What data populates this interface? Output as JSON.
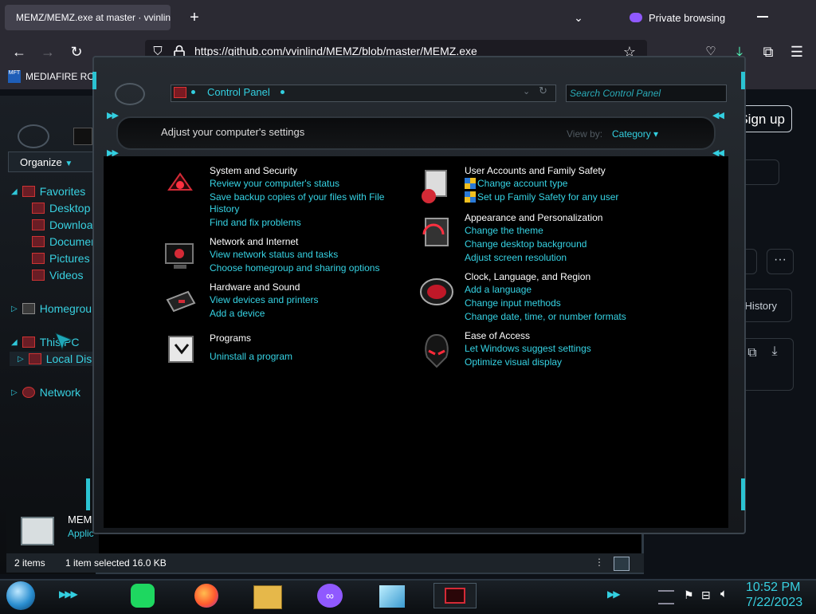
{
  "browser": {
    "tab_title": "MEMZ/MEMZ.exe at master · vvinlind/MEMZ",
    "new_tab_label": "+",
    "private_label": "Private browsing",
    "url": "https://github.com/vvinlind/MEMZ/blob/master/MEMZ.exe",
    "bookmark": "MEDIAFIRE RO",
    "bookmark_icon_text": "MFT"
  },
  "github": {
    "signup_label": "Sign up",
    "history_label": "History",
    "more_label": "···"
  },
  "explorer": {
    "organize_label": "Organize",
    "nav": {
      "favorites": "Favorites",
      "desktop": "Desktop",
      "downloads": "Downloa",
      "documents": "Documen",
      "pictures": "Pictures",
      "videos": "Videos",
      "homegroup": "Homegroup",
      "thispc": "This PC",
      "localdisk": "Local Dis",
      "network": "Network"
    },
    "details_name": "MEM",
    "details_type": "Applic",
    "status_items": "2 items",
    "status_selected": "1 item selected  16.0 KB"
  },
  "control_panel": {
    "address": "Control Panel",
    "search_placeholder": "Search Control Panel",
    "header": "Adjust your computer's settings",
    "view_by_label": "View by:",
    "view_by_value": "Category ▾",
    "categories": {
      "system": {
        "title": "System and Security",
        "links": [
          "Review your computer's status",
          "Save backup copies of your files with File",
          "History",
          "Find and fix problems"
        ]
      },
      "network": {
        "title": "Network and Internet",
        "links": [
          "View network status and tasks",
          "Choose homegroup and sharing options"
        ]
      },
      "hardware": {
        "title": "Hardware and Sound",
        "links": [
          "View devices and printers",
          "Add a device"
        ]
      },
      "programs": {
        "title": "Programs",
        "links": [
          "Uninstall a program"
        ]
      },
      "accounts": {
        "title": "User Accounts and Family Safety",
        "links": [
          "Change account type",
          "Set up Family Safety for any user"
        ]
      },
      "appearance": {
        "title": "Appearance and Personalization",
        "links": [
          "Change the theme",
          "Change desktop background",
          "Adjust screen resolution"
        ]
      },
      "clock": {
        "title": "Clock, Language, and Region",
        "links": [
          "Add a language",
          "Change input methods",
          "Change date, time, or number formats"
        ]
      },
      "ease": {
        "title": "Ease of Access",
        "links": [
          "Let Windows suggest settings",
          "Optimize visual display"
        ]
      }
    }
  },
  "taskbar": {
    "time": "10:52 PM",
    "date": "7/22/2023"
  },
  "colors": {
    "accent": "#36d3e4",
    "danger": "#d42a36",
    "window_bg": "#000000"
  }
}
